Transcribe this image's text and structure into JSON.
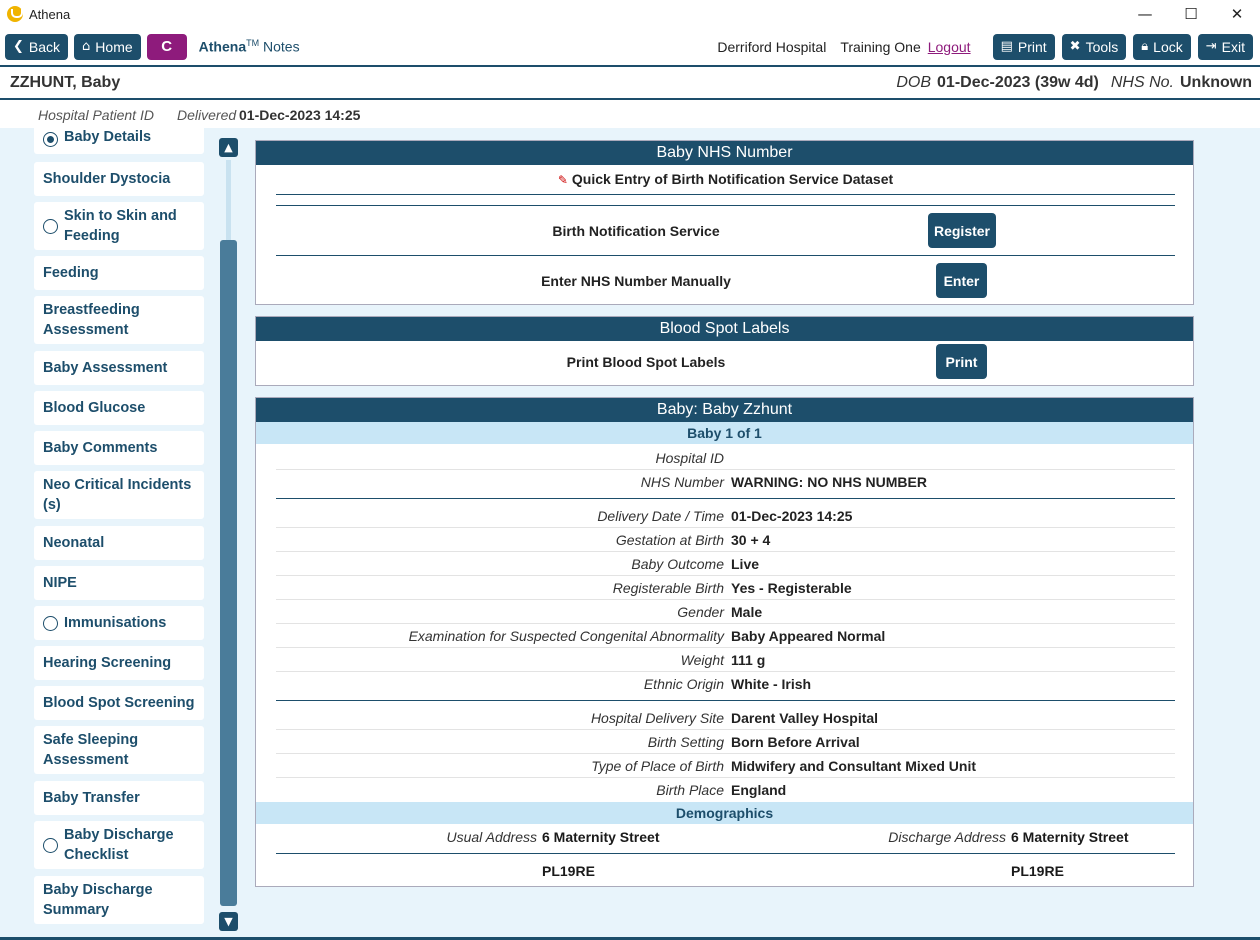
{
  "window": {
    "title": "Athena",
    "minimize": "—",
    "maximize": "☐",
    "close": "✕"
  },
  "toolbar": {
    "back": "Back",
    "home": "Home",
    "c_button": "C",
    "brand_name": "Athena",
    "brand_tm": "TM",
    "brand_suffix": "Notes",
    "hospital": "Derriford Hospital",
    "user": "Training One",
    "logout": "Logout",
    "print": "Print",
    "tools": "Tools",
    "lock": "Lock",
    "exit": "Exit"
  },
  "patient": {
    "name": "ZZHUNT, Baby",
    "dob_label": "DOB",
    "dob_value": "01-Dec-2023 (39w 4d)",
    "nhs_label": "NHS No.",
    "nhs_value": "Unknown"
  },
  "subbar": {
    "hospital_id_label": "Hospital Patient ID",
    "delivered_label": "Delivered",
    "delivered_value": "01-Dec-2023 14:25"
  },
  "sidebar": {
    "items": [
      {
        "label": "Baby Details",
        "radio": "filled"
      },
      {
        "label": "Shoulder Dystocia"
      },
      {
        "label": "Skin to Skin and Feeding",
        "radio": "empty"
      },
      {
        "label": "Feeding"
      },
      {
        "label": "Breastfeeding Assessment"
      },
      {
        "label": "Baby Assessment"
      },
      {
        "label": "Blood Glucose"
      },
      {
        "label": "Baby Comments"
      },
      {
        "label": "Neo Critical Incidents (s)"
      },
      {
        "label": "Neonatal"
      },
      {
        "label": "NIPE"
      },
      {
        "label": "Immunisations",
        "radio": "empty"
      },
      {
        "label": "Hearing Screening"
      },
      {
        "label": "Blood Spot Screening"
      },
      {
        "label": "Safe Sleeping Assessment"
      },
      {
        "label": "Baby Transfer"
      },
      {
        "label": "Baby Discharge Checklist",
        "radio": "empty"
      },
      {
        "label": "Baby Discharge Summary"
      }
    ]
  },
  "nhs_panel": {
    "title": "Baby NHS Number",
    "quick_entry": "Quick Entry of Birth Notification Service Dataset",
    "bns_label": "Birth Notification Service",
    "register_button": "Register",
    "manual_label": "Enter NHS Number Manually",
    "enter_button": "Enter"
  },
  "blood_spot_panel": {
    "title": "Blood Spot Labels",
    "label": "Print Blood Spot Labels",
    "print_button": "Print"
  },
  "baby_panel": {
    "title": "Baby: Baby Zzhunt",
    "counter": "Baby 1 of  1",
    "fields_a": [
      {
        "k": "Hospital ID",
        "v": ""
      },
      {
        "k": "NHS Number",
        "v": "WARNING: NO NHS NUMBER"
      }
    ],
    "fields_b": [
      {
        "k": "Delivery Date / Time",
        "v": "01-Dec-2023 14:25"
      },
      {
        "k": "Gestation at Birth",
        "v": "30 + 4"
      },
      {
        "k": "Baby Outcome",
        "v": "Live"
      },
      {
        "k": "Registerable Birth",
        "v": "Yes - Registerable"
      },
      {
        "k": "Gender",
        "v": "Male"
      },
      {
        "k": "Examination for Suspected Congenital Abnormality",
        "v": "Baby Appeared Normal"
      },
      {
        "k": "Weight",
        "v": "111 g"
      },
      {
        "k": "Ethnic Origin",
        "v": "White - Irish"
      }
    ],
    "fields_c": [
      {
        "k": "Hospital Delivery Site",
        "v": "Darent Valley Hospital"
      },
      {
        "k": "Birth Setting",
        "v": "Born Before Arrival"
      },
      {
        "k": "Type of Place of Birth",
        "v": "Midwifery and Consultant Mixed Unit"
      },
      {
        "k": "Birth Place",
        "v": "England"
      }
    ],
    "demographics": {
      "title": "Demographics",
      "usual_label": "Usual Address",
      "usual_value": "6 Maternity Street",
      "discharge_label": "Discharge Address",
      "discharge_value": "6 Maternity Street",
      "usual_postcode": "PL19RE",
      "discharge_postcode": "PL19RE"
    }
  },
  "colors": {
    "primary": "#1d4e6b",
    "accent": "#8e1b7c",
    "background": "#e8f4fb",
    "subheader": "#c8e6f6"
  },
  "icons": [
    "chevron-left-icon",
    "home-icon",
    "print-icon",
    "tools-icon",
    "lock-icon",
    "exit-icon",
    "pencil-icon",
    "chevron-up-icon",
    "chevron-down-icon"
  ]
}
